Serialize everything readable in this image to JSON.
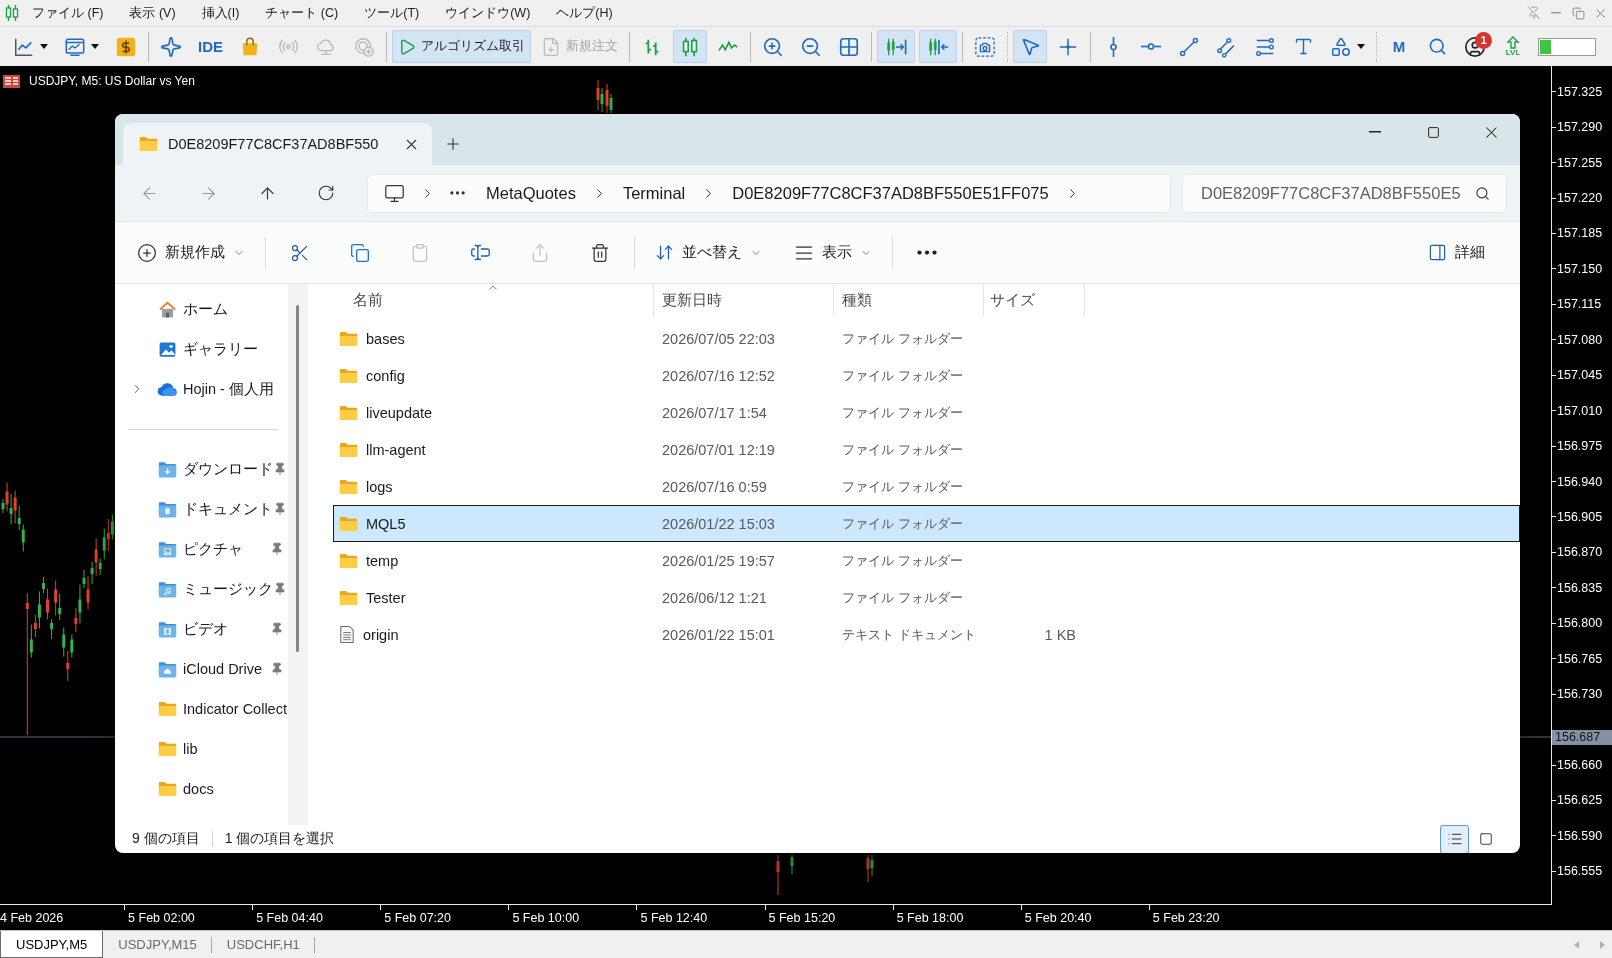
{
  "menu_bar": {
    "items": [
      "ファイル (F)",
      "表示 (V)",
      "挿入(I)",
      "チャート (C)",
      "ツール(T)",
      "ウインドウ(W)",
      "ヘルプ(H)"
    ]
  },
  "toolbar": {
    "groups": [
      [
        {
          "selected": false,
          "disabled": false
        },
        {
          "selected": false,
          "disabled": false
        },
        {
          "selected": false,
          "disabled": false
        }
      ],
      [
        {
          "selected": false,
          "disabled": false
        },
        {
          "label": "IDE",
          "selected": false,
          "disabled": false
        },
        {
          "selected": false,
          "disabled": false
        },
        {
          "selected": false,
          "disabled": true
        },
        {
          "selected": false,
          "disabled": true
        },
        {
          "selected": false,
          "disabled": true
        }
      ],
      [
        {
          "label": "アルゴリズム取引",
          "selected": true,
          "disabled": false
        },
        {
          "label": "新規注文",
          "selected": false,
          "disabled": true
        }
      ],
      [
        {
          "selected": false,
          "disabled": false
        },
        {
          "selected": true,
          "disabled": false
        },
        {
          "selected": false,
          "disabled": false
        }
      ],
      [
        {
          "selected": false,
          "disabled": false
        },
        {
          "selected": false,
          "disabled": false
        },
        {
          "selected": false,
          "disabled": false
        }
      ],
      [
        {
          "selected": true,
          "disabled": false
        },
        {
          "selected": true,
          "disabled": false
        }
      ],
      [
        {
          "selected": false,
          "disabled": false
        }
      ],
      [
        {
          "selected": true,
          "disabled": false
        },
        {
          "selected": false,
          "disabled": false
        }
      ],
      [
        {
          "selected": false,
          "disabled": false
        },
        {
          "selected": false,
          "disabled": false
        },
        {
          "selected": false,
          "disabled": false
        },
        {
          "selected": false,
          "disabled": false
        },
        {
          "selected": false,
          "disabled": false
        },
        {
          "selected": false,
          "disabled": false
        },
        {
          "selected": false,
          "disabled": false
        }
      ],
      [
        {
          "label": "M",
          "selected": false,
          "disabled": false
        },
        {
          "selected": false,
          "disabled": false
        },
        {
          "badge": "1",
          "selected": false,
          "disabled": false
        },
        {
          "label": "LVL",
          "selected": false,
          "disabled": false
        }
      ]
    ],
    "meter": {
      "level": 0.2
    }
  },
  "chart": {
    "title": "USDJPY, M5: US Dollar vs Yen",
    "price_axis": [
      {
        "kind": "tick",
        "label": "157.325"
      },
      {
        "kind": "tick",
        "label": "157.290"
      },
      {
        "kind": "tick",
        "label": "157.255"
      },
      {
        "kind": "tick",
        "label": "157.220"
      },
      {
        "kind": "tick",
        "label": "157.185"
      },
      {
        "kind": "tick",
        "label": "157.150"
      },
      {
        "kind": "tick",
        "label": "157.115"
      },
      {
        "kind": "tick",
        "label": "157.080"
      },
      {
        "kind": "tick",
        "label": "157.045"
      },
      {
        "kind": "tick",
        "label": "157.010"
      },
      {
        "kind": "tick",
        "label": "156.975"
      },
      {
        "kind": "tick",
        "label": "156.940"
      },
      {
        "kind": "tick",
        "label": "156.905"
      },
      {
        "kind": "tick",
        "label": "156.870"
      },
      {
        "kind": "tick",
        "label": "156.835"
      },
      {
        "kind": "tick",
        "label": "156.800"
      },
      {
        "kind": "tick",
        "label": "156.765"
      },
      {
        "kind": "tick",
        "label": "156.730"
      },
      {
        "kind": "current",
        "label": "156.687"
      },
      {
        "kind": "tick",
        "label": "156.660"
      },
      {
        "kind": "tick",
        "label": "156.625"
      },
      {
        "kind": "tick",
        "label": "156.590"
      },
      {
        "kind": "tick",
        "label": "156.555"
      }
    ],
    "time_axis": [
      "4 Feb 2026",
      "5 Feb 02:00",
      "5 Feb 04:40",
      "5 Feb 07:20",
      "5 Feb 10:00",
      "5 Feb 12:40",
      "5 Feb 15:20",
      "5 Feb 18:00",
      "5 Feb 20:40",
      "5 Feb 23:20"
    ]
  },
  "explorer": {
    "tabs": [
      {
        "label": "D0E8209F77C8CF37AD8BF550",
        "selected": true
      }
    ],
    "breadcrumb": [
      "MetaQuotes",
      "Terminal",
      "D0E8209F77C8CF37AD8BF550E51FF075"
    ],
    "search": {
      "placeholder": "D0E8209F77C8CF37AD8BF550E5"
    },
    "commands": [
      [
        {
          "label": "新規作成",
          "disabled": false
        }
      ],
      [
        {
          "disabled": false
        },
        {
          "disabled": false
        },
        {
          "disabled": true
        },
        {
          "disabled": false
        },
        {
          "disabled": true
        },
        {
          "disabled": false
        }
      ],
      [
        {
          "label": "並べ替え",
          "disabled": false
        },
        {
          "label": "表示",
          "disabled": false
        }
      ],
      [
        {
          "disabled": false
        }
      ]
    ],
    "details_button": {
      "label": "詳細"
    },
    "sidebar": {
      "nav": [
        {
          "label": "ホーム"
        },
        {
          "label": "ギャラリー"
        },
        {
          "label": "Hojin - 個人用",
          "expanded": false
        }
      ],
      "quick_access": [
        {
          "label": "ダウンロード",
          "pinned": true
        },
        {
          "label": "ドキュメント",
          "pinned": true
        },
        {
          "label": "ピクチャ",
          "pinned": true
        },
        {
          "label": "ミュージック",
          "pinned": true
        },
        {
          "label": "ビデオ",
          "pinned": true
        },
        {
          "label": "iCloud Drive",
          "pinned": true
        },
        {
          "label": "Indicator Collect",
          "pinned": false
        },
        {
          "label": "lib",
          "pinned": false
        },
        {
          "label": "docs",
          "pinned": false
        }
      ]
    },
    "file_list": {
      "columns": [
        {
          "label": "名前",
          "sorted": true
        },
        {
          "label": "更新日時",
          "sorted": false
        },
        {
          "label": "種類",
          "sorted": false
        },
        {
          "label": "サイズ",
          "sorted": false
        }
      ],
      "rows": [
        {
          "kind": "folder",
          "name": "bases",
          "modified": "2026/07/05 22:03",
          "type": "ファイル フォルダー",
          "selected": false
        },
        {
          "kind": "folder",
          "name": "config",
          "modified": "2026/07/16 12:52",
          "type": "ファイル フォルダー",
          "selected": false
        },
        {
          "kind": "folder",
          "name": "liveupdate",
          "modified": "2026/07/17 1:54",
          "type": "ファイル フォルダー",
          "selected": false
        },
        {
          "kind": "folder",
          "name": "llm-agent",
          "modified": "2026/07/01 12:19",
          "type": "ファイル フォルダー",
          "selected": false
        },
        {
          "kind": "folder",
          "name": "logs",
          "modified": "2026/07/16 0:59",
          "type": "ファイル フォルダー",
          "selected": false
        },
        {
          "kind": "folder",
          "name": "MQL5",
          "modified": "2026/01/22 15:03",
          "type": "ファイル フォルダー",
          "selected": true
        },
        {
          "kind": "folder",
          "name": "temp",
          "modified": "2026/01/25 19:57",
          "type": "ファイル フォルダー",
          "selected": false
        },
        {
          "kind": "folder",
          "name": "Tester",
          "modified": "2026/06/12 1:21",
          "type": "ファイル フォルダー",
          "selected": false
        },
        {
          "kind": "file",
          "name": "origin",
          "modified": "2026/01/22 15:01",
          "type": "テキスト ドキュメント",
          "size": "1 KB",
          "selected": false
        }
      ]
    },
    "status_bar": {
      "item_count": "9 個の項目",
      "selection": "1 個の項目を選択"
    },
    "view_buttons": [
      {
        "selected": true
      },
      {
        "selected": false
      }
    ]
  },
  "chart_tabs": [
    {
      "label": "USDJPY,M5",
      "selected": true
    },
    {
      "label": "USDJPY,M15",
      "selected": false
    },
    {
      "label": "USDCHF,H1",
      "selected": false
    }
  ]
}
